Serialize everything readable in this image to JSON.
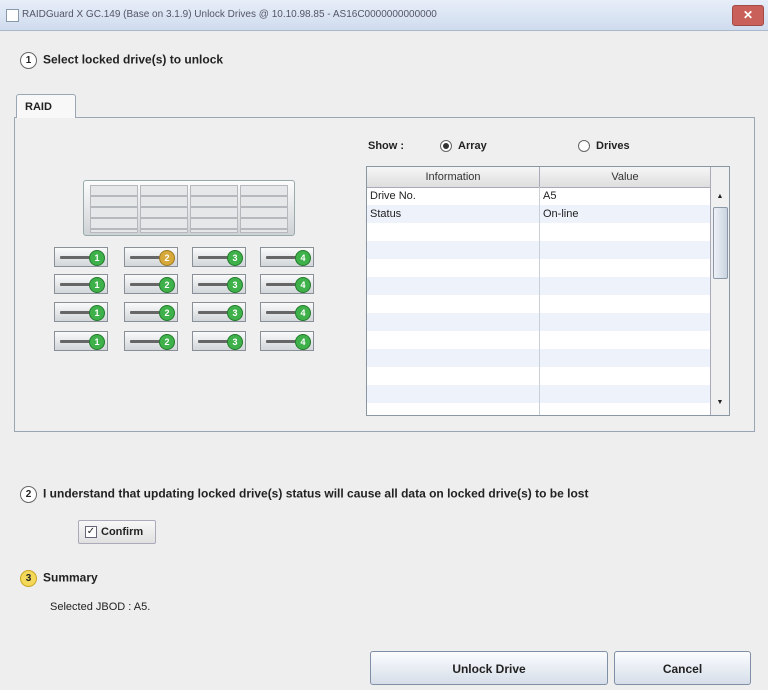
{
  "window": {
    "title": "RAIDGuard X GC.149 (Base on 3.1.9) Unlock Drives @ 10.10.98.85 - AS16C0000000000000",
    "close_glyph": "✕"
  },
  "step1": {
    "num": "1",
    "label": "Select locked drive(s) to unlock"
  },
  "tab": {
    "label": "RAID"
  },
  "show": {
    "label": "Show :",
    "options": [
      {
        "label": "Array",
        "selected": true
      },
      {
        "label": "Drives",
        "selected": false
      }
    ]
  },
  "table": {
    "headers": [
      "Information",
      "Value"
    ],
    "rows": [
      [
        "Drive No.",
        "A5"
      ],
      [
        "Status",
        "On-line"
      ],
      [
        "",
        ""
      ],
      [
        "",
        ""
      ],
      [
        "",
        ""
      ],
      [
        "",
        ""
      ],
      [
        "",
        ""
      ],
      [
        "",
        ""
      ],
      [
        "",
        ""
      ],
      [
        "",
        ""
      ],
      [
        "",
        ""
      ],
      [
        "",
        ""
      ]
    ]
  },
  "drives": [
    [
      "1",
      "2",
      "3",
      "4"
    ],
    [
      "1",
      "2",
      "3",
      "4"
    ],
    [
      "1",
      "2",
      "3",
      "4"
    ],
    [
      "1",
      "2",
      "3",
      "4"
    ]
  ],
  "drive_icons": {
    "locked": "lock-icon",
    "unlocked": "drive-status-icon"
  },
  "step2": {
    "num": "2",
    "label": "I understand that updating locked drive(s) status will cause all data on locked drive(s) to be lost"
  },
  "confirm": {
    "label": "Confirm",
    "checked": true,
    "check_glyph": "✓"
  },
  "step3": {
    "num": "3",
    "label": "Summary",
    "text": "Selected JBOD : A5."
  },
  "buttons": {
    "unlock": "Unlock Drive",
    "cancel": "Cancel"
  },
  "colors": {
    "drive_ok": "#3fb14a",
    "drive_locked": "#d6a93a",
    "title_close": "#c9605a"
  }
}
